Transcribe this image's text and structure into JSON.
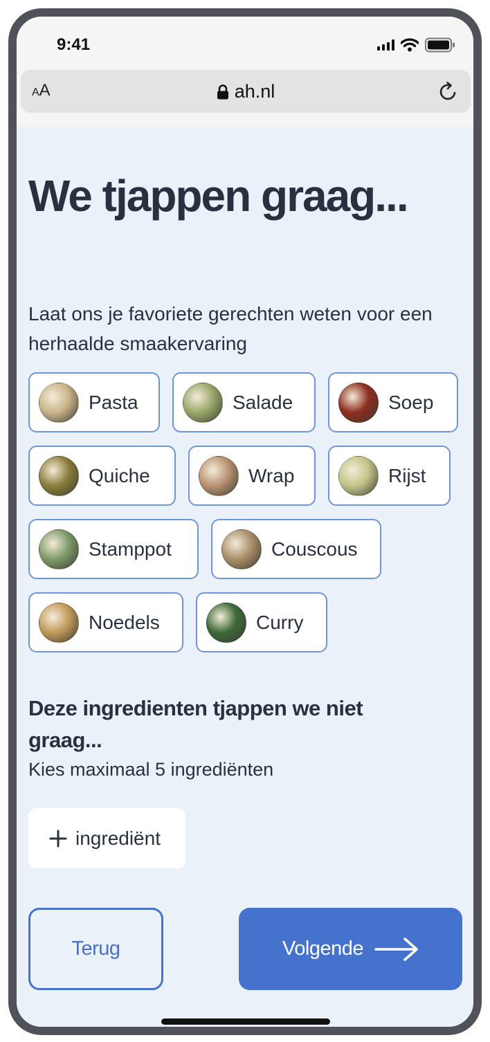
{
  "status_bar": {
    "time": "9:41"
  },
  "browser": {
    "aa_label": "A",
    "aa_small": "A",
    "url": "ah.nl"
  },
  "page": {
    "title": "We tjappen graag...",
    "subtitle": "Laat ons je favoriete gerechten weten voor een herhaalde smaakervaring"
  },
  "dishes": [
    {
      "label": "Pasta",
      "thumb_color": "#c9b48a"
    },
    {
      "label": "Salade",
      "thumb_color": "#9aa86a"
    },
    {
      "label": "Soep",
      "thumb_color": "#8e2d1f"
    },
    {
      "label": "Quiche",
      "thumb_color": "#8a7d3c"
    },
    {
      "label": "Wrap",
      "thumb_color": "#b89272"
    },
    {
      "label": "Rijst",
      "thumb_color": "#c2c48a"
    },
    {
      "label": "Stamppot",
      "thumb_color": "#7e9a6a"
    },
    {
      "label": "Couscous",
      "thumb_color": "#a98e6a"
    },
    {
      "label": "Noedels",
      "thumb_color": "#c29a5a"
    },
    {
      "label": "Curry",
      "thumb_color": "#3d6a3a"
    }
  ],
  "ingredients": {
    "title": "Deze ingredienten tjappen we niet graag...",
    "hint": "Kies maximaal 5 ingrediënten",
    "add_label": "ingrediënt"
  },
  "navigation": {
    "back_label": "Terug",
    "next_label": "Volgende"
  },
  "colors": {
    "accent": "#4472cc",
    "chip_border": "#6d94dc",
    "background": "#ebf1f9",
    "text": "#27313f"
  }
}
